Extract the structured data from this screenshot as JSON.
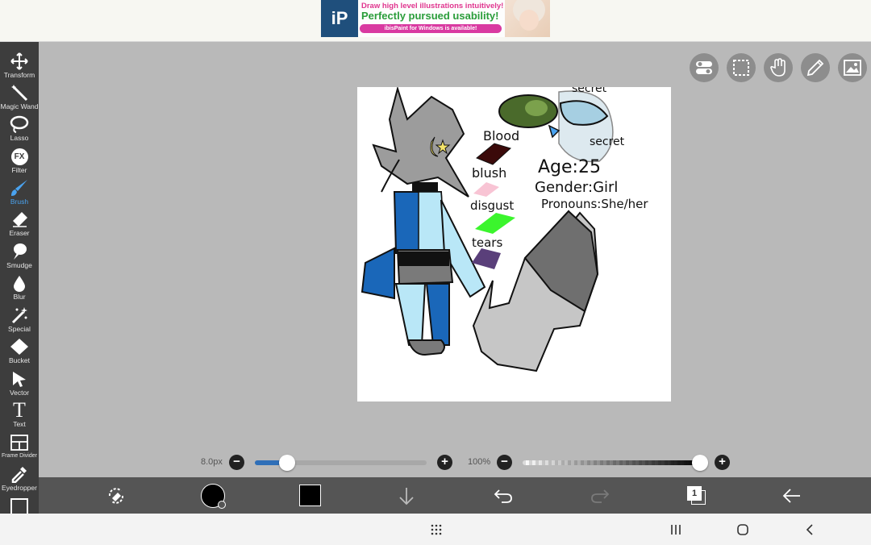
{
  "ad": {
    "logo": "iP",
    "line1": "Draw high level illustrations intuitively!",
    "line2": "Perfectly pursued usability!",
    "line3": "ibisPaint for Windows is available!"
  },
  "tools": [
    {
      "label": "Transform",
      "icon": "transform-icon",
      "active": false
    },
    {
      "label": "Magic Wand",
      "icon": "magic-wand-icon",
      "active": false
    },
    {
      "label": "Lasso",
      "icon": "lasso-icon",
      "active": false
    },
    {
      "label": "Filter",
      "icon": "filter-icon",
      "active": false
    },
    {
      "label": "Brush",
      "icon": "brush-icon",
      "active": true
    },
    {
      "label": "Eraser",
      "icon": "eraser-icon",
      "active": false
    },
    {
      "label": "Smudge",
      "icon": "smudge-icon",
      "active": false
    },
    {
      "label": "Blur",
      "icon": "blur-icon",
      "active": false
    },
    {
      "label": "Special",
      "icon": "special-icon",
      "active": false
    },
    {
      "label": "Bucket",
      "icon": "bucket-icon",
      "active": false
    },
    {
      "label": "Vector",
      "icon": "vector-icon",
      "active": false
    },
    {
      "label": "Text",
      "icon": "text-icon",
      "active": false
    },
    {
      "label": "Frame Divider",
      "icon": "frame-divider-icon",
      "active": false
    },
    {
      "label": "Eyedropper",
      "icon": "eyedropper-icon",
      "active": false
    }
  ],
  "filter_icon_text": "FX",
  "text_icon_text": "T",
  "quick_buttons": [
    "toggle-icon",
    "selection-icon",
    "hand-icon",
    "pen-icon",
    "image-icon"
  ],
  "artwork": {
    "labels": {
      "secret_top": "secret",
      "secret": "secret",
      "blood": "Blood",
      "blush": "blush",
      "disgust": "disgust",
      "tears": "tears",
      "age": "Age:25",
      "gender": "Gender:Girl",
      "pronouns": "Pronouns:She/her"
    },
    "swatch_colors": {
      "blood": "#3b0a0a",
      "blush": "#f8c4d4",
      "disgust": "#3bf52d",
      "tears": "#5a3f7a"
    }
  },
  "brush": {
    "size_label": "8.0px",
    "size_fraction": 0.19,
    "opacity_label": "100%",
    "opacity_fraction": 1.0
  },
  "bottom_bar": {
    "color_swatch": "#000000",
    "secondary_color": "#000000",
    "layer_count": "1"
  },
  "colors": {
    "toolbar_bg": "#3d3d3d",
    "active_tool": "#4aa3f0",
    "canvas_bg": "#b9b9b9",
    "slider_accent": "#2f6fb8"
  }
}
